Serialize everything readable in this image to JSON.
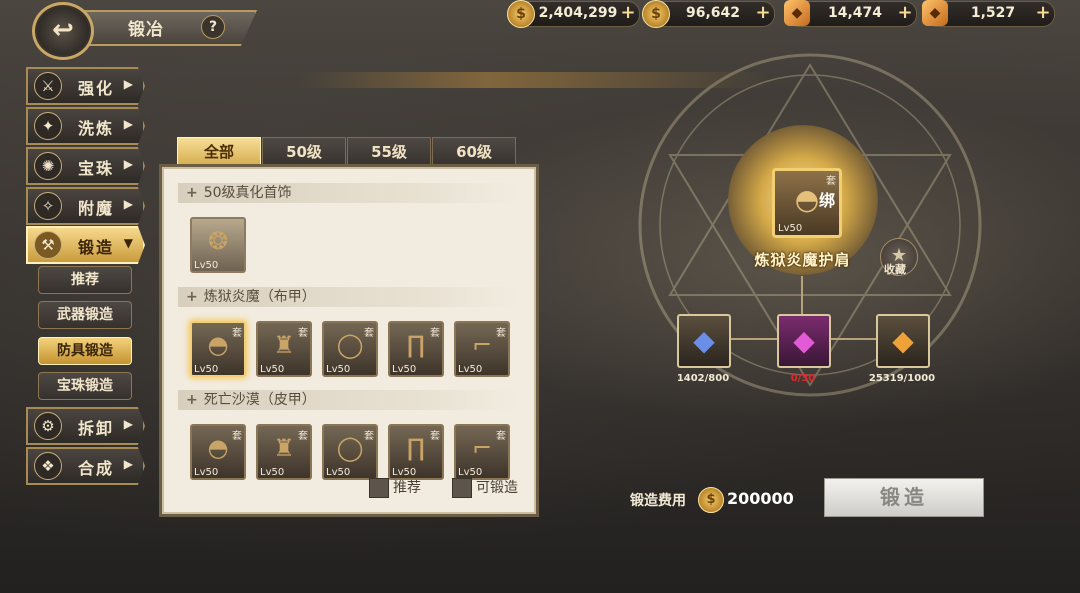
{
  "header": {
    "title": "锻冶",
    "back_icon": "back-arrow-icon",
    "help_label": "?"
  },
  "currencies": [
    {
      "icon": "gold-coin-icon",
      "value": "2,404,299",
      "glyph": "$"
    },
    {
      "icon": "gold-coin-icon",
      "value": "96,642",
      "glyph": "$"
    },
    {
      "icon": "orange-crystal-icon",
      "value": "14,474",
      "glyph": "◆"
    },
    {
      "icon": "amber-crystal-icon",
      "value": "1,527",
      "glyph": "◆"
    }
  ],
  "add_label": "+",
  "nav": {
    "items": [
      {
        "label": "强化",
        "icon": "enhance-icon",
        "glyph": "⚔",
        "arrow": "▶"
      },
      {
        "label": "洗炼",
        "icon": "refine-icon",
        "glyph": "✦",
        "arrow": "▶"
      },
      {
        "label": "宝珠",
        "icon": "orb-icon",
        "glyph": "✺",
        "arrow": "▶"
      },
      {
        "label": "附魔",
        "icon": "enchant-icon",
        "glyph": "✧",
        "arrow": "▶"
      },
      {
        "label": "锻造",
        "icon": "anvil-icon",
        "glyph": "⚒",
        "arrow": "▼"
      },
      {
        "label": "拆卸",
        "icon": "dismantle-icon",
        "glyph": "⚙",
        "arrow": "▶"
      },
      {
        "label": "合成",
        "icon": "synthesis-icon",
        "glyph": "❖",
        "arrow": "▶"
      }
    ],
    "subitems": [
      "推荐",
      "武器锻造",
      "防具锻造",
      "宝珠锻造"
    ]
  },
  "tabs": [
    "全部",
    "50级",
    "55级",
    "60级"
  ],
  "panel": {
    "sections": [
      {
        "title": "50级真化首饰",
        "plus": "+",
        "items": [
          {
            "lv": "Lv50",
            "glyph": "❂",
            "set": ""
          }
        ]
      },
      {
        "title": "炼狱炎魔（布甲）",
        "plus": "+",
        "items": [
          {
            "lv": "Lv50",
            "glyph": "◓",
            "set": "套"
          },
          {
            "lv": "Lv50",
            "glyph": "♜",
            "set": "套"
          },
          {
            "lv": "Lv50",
            "glyph": "◯",
            "set": "套"
          },
          {
            "lv": "Lv50",
            "glyph": "∏",
            "set": "套"
          },
          {
            "lv": "Lv50",
            "glyph": "⌐",
            "set": "套"
          }
        ]
      },
      {
        "title": "死亡沙漠（皮甲）",
        "plus": "+",
        "items": [
          {
            "lv": "Lv50",
            "glyph": "◓",
            "set": "套"
          },
          {
            "lv": "Lv50",
            "glyph": "♜",
            "set": "套"
          },
          {
            "lv": "Lv50",
            "glyph": "◯",
            "set": "套"
          },
          {
            "lv": "Lv50",
            "glyph": "∏",
            "set": "套"
          },
          {
            "lv": "Lv50",
            "glyph": "⌐",
            "set": "套"
          }
        ]
      }
    ],
    "filters": [
      "推荐",
      "可锻造"
    ]
  },
  "forge": {
    "item": {
      "name": "炼狱炎魔护肩",
      "lv": "Lv50",
      "set": "套",
      "bound": "绑",
      "glyph": "◓"
    },
    "favorite_label": "收藏",
    "favorite_glyph": "★",
    "materials": [
      {
        "icon": "blue-crystal-icon",
        "count": "1402/800",
        "color": "#6b8fe8",
        "glyph": "◆",
        "enough": true
      },
      {
        "icon": "pink-crystal-icon",
        "count": "0/30",
        "color": "#e35ad6",
        "glyph": "◆",
        "enough": false
      },
      {
        "icon": "orange-crystal-icon",
        "count": "25319/1000",
        "color": "#f0a23a",
        "glyph": "◆",
        "enough": true
      }
    ],
    "cost_label": "锻造费用",
    "cost_value": "200000",
    "button_label": "锻造"
  }
}
